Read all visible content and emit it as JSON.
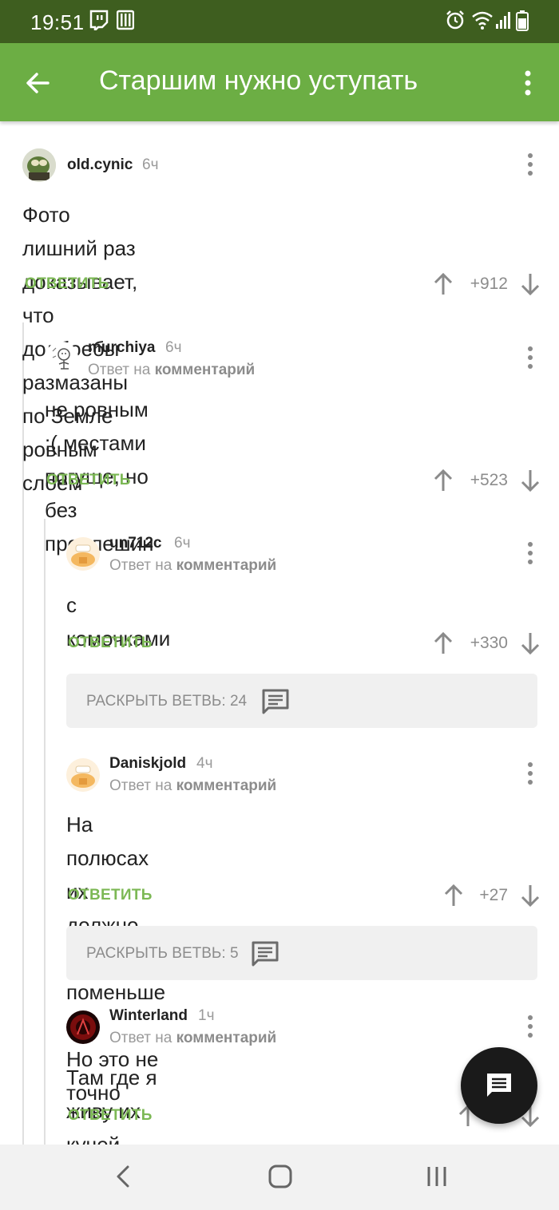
{
  "status_bar": {
    "time": "19:51",
    "icons": [
      "twitch-icon",
      "bars-notification-icon",
      "alarm-icon",
      "wifi-icon",
      "signal-icon",
      "battery-icon"
    ]
  },
  "app_bar": {
    "title": "Старшим нужно уступать",
    "back_icon": "arrow-left-icon",
    "menu_icon": "more-vertical-icon"
  },
  "reply_prefix": "Ответ на",
  "reply_target": "комментарий",
  "reply_label": "ОТВЕТИТЬ",
  "comments": [
    {
      "username": "old.cynic",
      "time": "6ч",
      "text_lines": [
        "Фото лишний раз доказывает, что долбоебы",
        "размазаны по Земле ровным слоем"
      ],
      "score": "+912"
    },
    {
      "username": "murchiya",
      "time": "6ч",
      "text_lines": [
        "не ровным :( местами погуще, но без",
        "проплешин"
      ],
      "score": "+523"
    },
    {
      "username": "un712c",
      "time": "6ч",
      "text_lines": [
        "с комочками"
      ],
      "score": "+330"
    },
    {
      "username": "Daniskjold",
      "time": "4ч",
      "text_lines": [
        "На полюсах их должно быть поменьше ...",
        "Но это не точно"
      ],
      "score": "+27"
    },
    {
      "username": "Winterland",
      "time": "1ч",
      "text_lines": [
        "Там где я живу их кучей навалено."
      ],
      "score": ""
    }
  ],
  "expand_branches": [
    {
      "label": "РАСКРЫТЬ ВЕТВЬ: 24"
    },
    {
      "label": "РАСКРЫТЬ ВЕТВЬ: 5"
    }
  ],
  "fab": {
    "icon": "comment-icon"
  },
  "nav_bar": {
    "icons": [
      "back-nav-icon",
      "home-nav-icon",
      "recents-nav-icon"
    ]
  },
  "colors": {
    "status_bar": "#3e5e1f",
    "app_bar": "#6cae44",
    "reply_green": "#7cb855",
    "fab": "#1a1a1a"
  }
}
